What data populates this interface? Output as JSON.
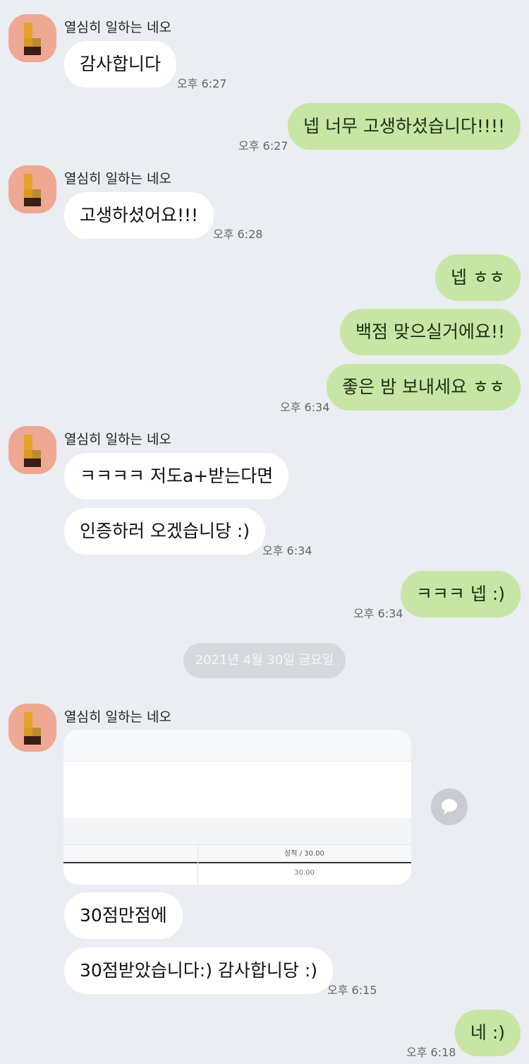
{
  "messages": [
    {
      "sender": "열심히 일하는 네오",
      "text": "감사합니다",
      "time": "오후 6:27"
    },
    {
      "text": "넵  너무 고생하셨습니다!!!!",
      "time": "오후 6:27"
    },
    {
      "sender": "열심히 일하는 네오",
      "text": "고생하셨어요!!!",
      "time": "오후 6:28"
    },
    {
      "text": "넵 ㅎㅎ"
    },
    {
      "text": "백점 맞으실거에요!!"
    },
    {
      "text": "좋은 밤 보내세요 ㅎㅎ",
      "time": "오후 6:34"
    },
    {
      "sender": "열심히 일하는 네오",
      "text": "ㅋㅋㅋㅋ 저도a+받는다면"
    },
    {
      "text": "인증하러 오겠습니당 :)",
      "time": "오후 6:34"
    },
    {
      "text": "ㅋㅋㅋ 넵 :)",
      "time": "오후 6:34"
    },
    {
      "sender": "열심히 일하는 네오"
    },
    {
      "text": "30점만점에"
    },
    {
      "text": "30점받았습니다:) 감사합니당 :)",
      "time": "오후 6:15"
    },
    {
      "text": "네 :)",
      "time": "오후 6:18"
    }
  ],
  "date_divider": "2021년 4월 30일 금요일",
  "score_card": {
    "header": "성적 / 30.00",
    "value": "30.00"
  },
  "icons": {
    "share": "speech-bubble-icon"
  },
  "colors": {
    "background": "#eaedf1",
    "incoming_bubble": "#ffffff",
    "outgoing_bubble": "#c7e6a5",
    "avatar": "#eea893"
  }
}
